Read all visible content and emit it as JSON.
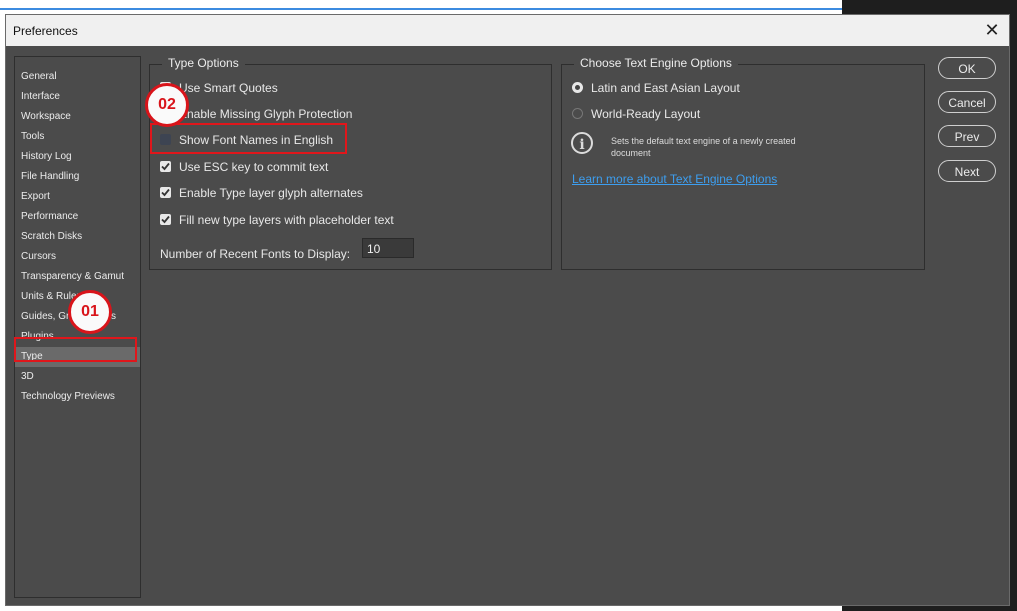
{
  "dialog": {
    "title": "Preferences",
    "close_glyph": "✕"
  },
  "sidebar": {
    "items": [
      {
        "label": "General"
      },
      {
        "label": "Interface"
      },
      {
        "label": "Workspace"
      },
      {
        "label": "Tools"
      },
      {
        "label": "History Log"
      },
      {
        "label": "File Handling"
      },
      {
        "label": "Export"
      },
      {
        "label": "Performance"
      },
      {
        "label": "Scratch Disks"
      },
      {
        "label": "Cursors"
      },
      {
        "label": "Transparency & Gamut"
      },
      {
        "label": "Units & Rulers"
      },
      {
        "label": "Guides, Grid & Slices"
      },
      {
        "label": "Plugins"
      },
      {
        "label": "Type",
        "selected": true
      },
      {
        "label": "3D"
      },
      {
        "label": "Technology Previews"
      }
    ]
  },
  "type_options": {
    "legend": "Type Options",
    "checkboxes": [
      {
        "label": "Use Smart Quotes",
        "checked": true
      },
      {
        "label": "Enable Missing Glyph Protection",
        "checked": true
      },
      {
        "label": "Show Font Names in English",
        "checked": false
      },
      {
        "label": "Use ESC key to commit text",
        "checked": true
      },
      {
        "label": "Enable Type layer glyph alternates",
        "checked": true
      },
      {
        "label": "Fill new type layers with placeholder text",
        "checked": true
      }
    ],
    "recent_fonts_label": "Number of Recent Fonts to Display:",
    "recent_fonts_value": "10"
  },
  "text_engine": {
    "legend": "Choose Text Engine Options",
    "options": [
      {
        "label": "Latin and East Asian Layout",
        "selected": true
      },
      {
        "label": "World-Ready Layout",
        "selected": false
      }
    ],
    "info_icon": "info-icon",
    "info_text": "Sets the default text engine of a newly created document",
    "learn_more": "Learn more about Text Engine Options"
  },
  "buttons": {
    "ok": "OK",
    "cancel": "Cancel",
    "prev": "Prev",
    "next": "Next"
  },
  "annotations": {
    "badge_1": "01",
    "badge_2": "02",
    "highlight_color": "#e0161b"
  },
  "colors": {
    "panel_bg": "#4b4b4b",
    "link": "#3d9eef"
  }
}
